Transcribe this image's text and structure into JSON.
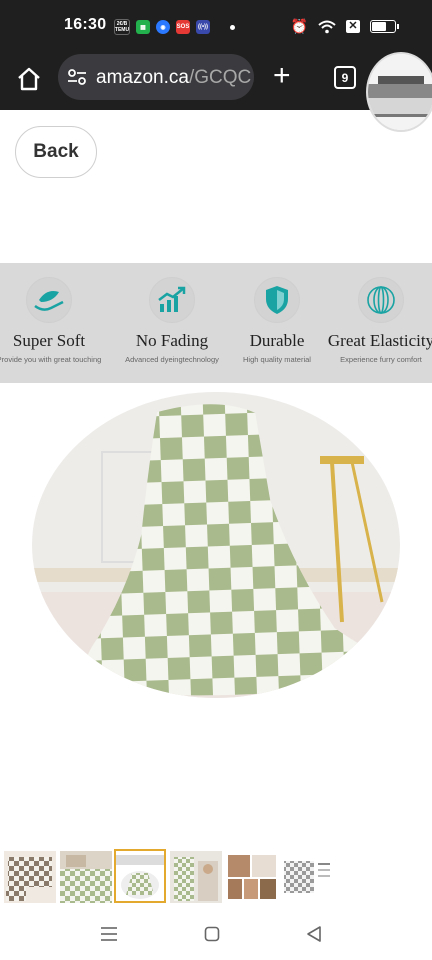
{
  "status_bar": {
    "time": "16:30",
    "app_icons": [
      {
        "name": "temu-app-icon",
        "text": "2€/B\nTEMU",
        "color": "#1f1f1f"
      },
      {
        "name": "green-app-icon",
        "text": "",
        "color": "#22b14c"
      },
      {
        "name": "blue-app-icon",
        "text": "",
        "color": "#2b79ff"
      },
      {
        "name": "sos-app-icon",
        "text": "SOS",
        "color": "#e53935"
      },
      {
        "name": "radio-app-icon",
        "text": "((•))",
        "color": "#3949ab"
      }
    ]
  },
  "browser": {
    "url_host": "amazon.ca",
    "url_path": "/GCQC",
    "tab_count": "9"
  },
  "page": {
    "back_label": "Back"
  },
  "features": [
    {
      "title": "Super Soft",
      "subtitle": "Provide you with great touching",
      "icon": "hand-leaf-icon"
    },
    {
      "title": "No Fading",
      "subtitle": "Advanced dyeingtechnology",
      "icon": "trend-chart-icon"
    },
    {
      "title": "Durable",
      "subtitle": "High quality material",
      "icon": "shield-icon"
    },
    {
      "title": "Great Elasticity",
      "subtitle": "Experience furry comfort",
      "icon": "elastic-circle-icon"
    }
  ],
  "colors": {
    "accent_teal": "#1aa3a3",
    "sage": "#a9ba8c",
    "thumb_selected_border": "#e3a82e"
  },
  "thumbnails": [
    {
      "name": "thumbnail-1",
      "selected": false
    },
    {
      "name": "thumbnail-2",
      "selected": false
    },
    {
      "name": "thumbnail-3",
      "selected": true
    },
    {
      "name": "thumbnail-4",
      "selected": false
    },
    {
      "name": "thumbnail-5",
      "selected": false
    },
    {
      "name": "thumbnail-6",
      "selected": false
    }
  ]
}
